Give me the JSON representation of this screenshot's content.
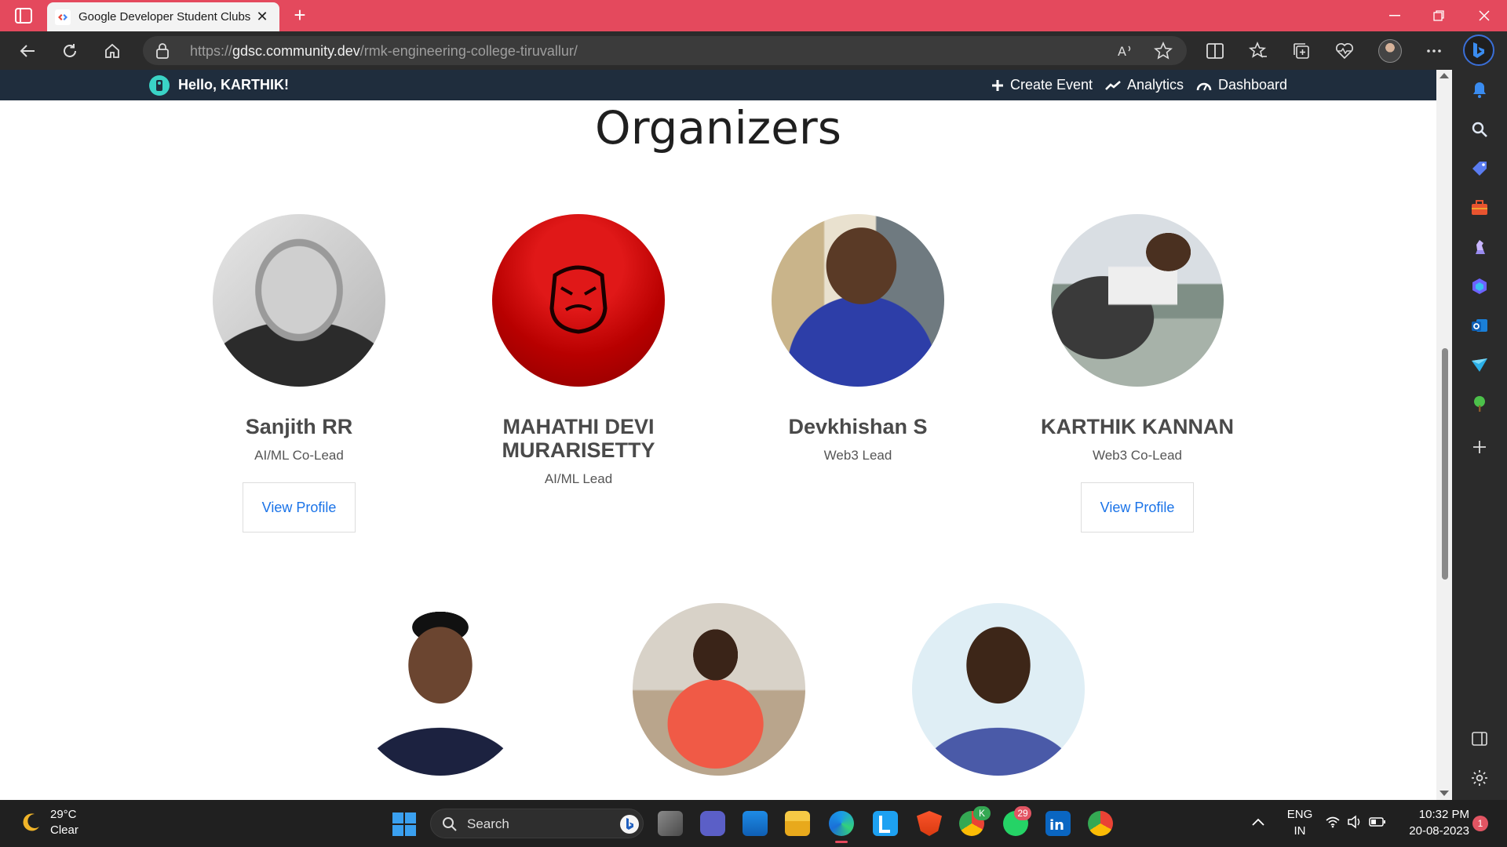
{
  "browser": {
    "tab_title": "Google Developer Student Clubs",
    "url_scheme": "https://",
    "url_host": "gdsc.community.dev",
    "url_path": "/rmk-engineering-college-tiruvallur/"
  },
  "site": {
    "greeting": "Hello, KARTHIK!",
    "nav": {
      "create_event": "Create Event",
      "analytics": "Analytics",
      "dashboard": "Dashboard"
    },
    "section_title": "Organizers",
    "view_profile_label": "View Profile",
    "organizers": [
      {
        "name": "Sanjith RR",
        "role": "AI/ML Co-Lead"
      },
      {
        "name": "MAHATHI DEVI MURARISETTY",
        "role": "AI/ML Lead"
      },
      {
        "name": "Devkhishan S",
        "role": "Web3 Lead"
      },
      {
        "name": "KARTHIK KANNAN",
        "role": "Web3 Co-Lead"
      }
    ]
  },
  "taskbar": {
    "temperature": "29°C",
    "condition": "Clear",
    "search_label": "Search",
    "whatsapp_badge": "29",
    "chrome_badge": "K",
    "lang_1": "ENG",
    "lang_2": "IN",
    "time": "10:32 PM",
    "date": "20-08-2023",
    "notification_count": "1"
  },
  "colors": {
    "titlebar": "#e4495d",
    "site_header": "#1f2d3d",
    "link_blue": "#1a73e8"
  }
}
